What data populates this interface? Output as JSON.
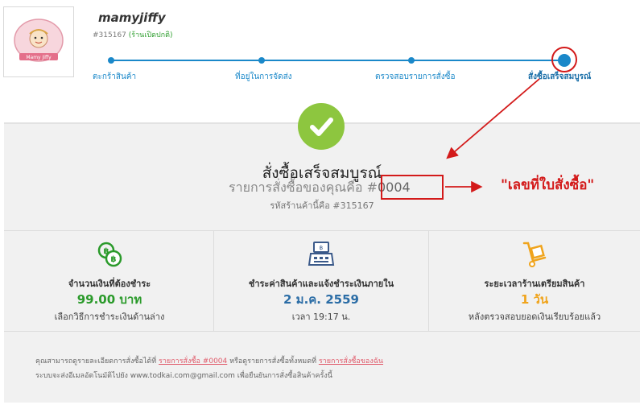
{
  "shop": {
    "name": "mamyjiffy",
    "id": "#315167",
    "status": "(ร้านเปิดปกติ)",
    "logo_text": "Mamy Jiffy"
  },
  "steps": [
    {
      "label": "ตะกร้าสินค้า"
    },
    {
      "label": "ที่อยู่ในการจัดส่ง"
    },
    {
      "label": "ตรวจสอบรายการสั่งซื้อ"
    },
    {
      "label": "สั่งซื้อเสร็จสมบูรณ์",
      "active": true
    }
  ],
  "success": {
    "title": "สั่งซื้อเสร็จสมบูรณ์",
    "order_prefix": "รายการสั่งซื้อของคุณคือ #",
    "order_number": "0004",
    "shop_code": "รหัสร้านค้านี้คือ #315167"
  },
  "annotation": {
    "label": "\"เลขที่ใบสั่งซื้อ\""
  },
  "cards": {
    "amount": {
      "label": "จำนวนเงินที่ต้องชำระ",
      "value": "99.00 บาท",
      "sub": "เลือกวิธีการชำระเงินด้านล่าง",
      "icon": "coins-icon"
    },
    "deadline": {
      "label": "ชำระค่าสินค้าและแจ้งชำระเงินภายใน",
      "value": "2 ม.ค. 2559",
      "sub": "เวลา 19:17 น.",
      "icon": "cash-register-icon"
    },
    "prep": {
      "label": "ระยะเวลาร้านเตรียมสินค้า",
      "value": "1 วัน",
      "sub": "หลังตรวจสอบยอดเงินเรียบร้อยแล้ว",
      "icon": "hand-truck-icon"
    }
  },
  "footer": {
    "line1_a": "คุณสามารถดูรายละเอียดการสั่งซื้อได้ที่ ",
    "link1": "รายการสั่งซื้อ #0004",
    "line1_b": " หรือดูรายการสั่งซื้อทั้งหมดที่ ",
    "link2": "รายการสั่งซื้อของฉัน",
    "line2": "ระบบจะส่งอีเมลอัตโนมัติไปยัง www.todkai.com@gmail.com เพื่อยืนยันการสั่งซื้อสินค้าครั้งนี้"
  },
  "colors": {
    "step_blue": "#1a88c9",
    "success_green": "#8dc63f",
    "annotation_red": "#d31a1a",
    "link_pink": "#e05b6b"
  }
}
